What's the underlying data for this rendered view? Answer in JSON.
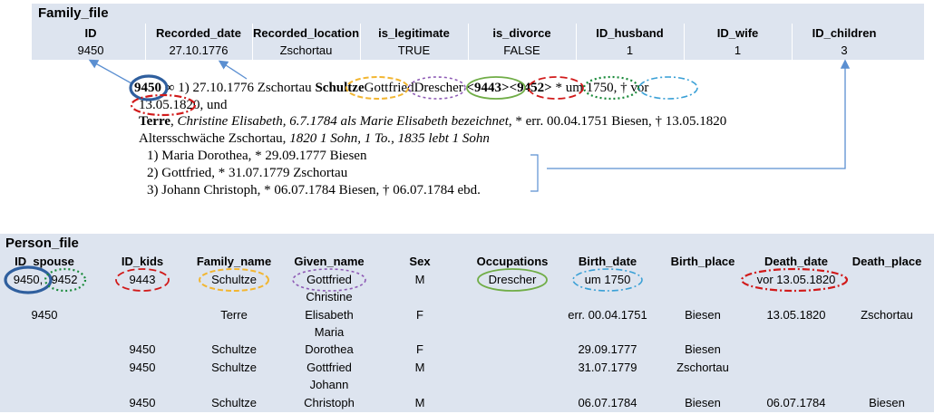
{
  "family_file": {
    "title": "Family_file",
    "headers": [
      "ID",
      "Recorded_date",
      "Recorded_location",
      "is_legitimate",
      "is_divorce",
      "ID_husband",
      "ID_wife",
      "ID_children"
    ],
    "row": [
      "9450",
      "27.10.1776",
      "Zschortau",
      "TRUE",
      "FALSE",
      "1",
      "1",
      "3"
    ]
  },
  "record": {
    "line1": {
      "id": "9450",
      "marriage_symbol": "∞",
      "text_a": "1) 27.10.1776 Zschortau",
      "family_name": "Schultze",
      "given_name": "Gottfried",
      "occupation": "Drescher",
      "id_a": "<9443>",
      "id_b": "<9452>",
      "birth": "* um 1750,",
      "death_pre": "† vor"
    },
    "line2": {
      "death_date": "13.05.1820,",
      "und": "und"
    },
    "line3": {
      "surname": "Terre",
      "given": "Christine Elisabeth,",
      "note": "6.7.1784 als Marie Elisabeth bezeichnet",
      "rest": ", * err. 00.04.1751 Biesen, † 13.05.1820"
    },
    "line4": {
      "text": "Altersschwäche Zschortau,",
      "note": "1820 1 Sohn, 1 To., 1835 lebt 1 Sohn"
    },
    "children": [
      "1) Maria Dorothea, * 29.09.1777 Biesen",
      "2) Gottfried, * 31.07.1779 Zschortau",
      "3) Johann Christoph, * 06.07.1784 Biesen, † 06.07.1784 ebd."
    ]
  },
  "person_file": {
    "title": "Person_file",
    "headers": [
      "ID_spouse",
      "ID_kids",
      "Family_name",
      "Given_name",
      "Sex",
      "Occupations",
      "Birth_date",
      "Birth_place",
      "Death_date",
      "Death_place"
    ],
    "row1": {
      "spouse_a": "9450,",
      "spouse_b": "9452",
      "kids": "9443",
      "family": "Schultze",
      "given": "Gottfried",
      "sex": "M",
      "occ": "Drescher",
      "birth": "um 1750",
      "death": "vor 13.05.1820"
    },
    "row2": {
      "spouse": "9450",
      "family": "Terre",
      "given_l1": "Christine",
      "given_l2": "Elisabeth",
      "sex": "F",
      "birth": "err. 00.04.1751",
      "birth_place": "Biesen",
      "death": "13.05.1820",
      "death_place": "Zschortau"
    },
    "row3": {
      "kids": "9450",
      "family": "Schultze",
      "given_l1": "Maria",
      "given_l2": "Dorothea",
      "sex": "F",
      "birth": "29.09.1777",
      "birth_place": "Biesen"
    },
    "row4": {
      "kids": "9450",
      "family": "Schultze",
      "given": "Gottfried",
      "sex": "M",
      "birth": "31.07.1779",
      "birth_place": "Zschortau"
    },
    "row5": {
      "kids": "9450",
      "family": "Schultze",
      "given_l1": "Johann",
      "given_l2": "Christoph",
      "sex": "M",
      "birth": "06.07.1784",
      "birth_place": "Biesen",
      "death": "06.07.1784",
      "death_place": "Biesen"
    }
  },
  "colors": {
    "table_band": "#dde4ef",
    "id_ring": "#2f5f9e",
    "arrow": "#5b8fd1",
    "family_name": "#f2b632",
    "given_name": "#8e5bb5",
    "occupation": "#70ad47",
    "id_red": "#d11a1a",
    "id_green": "#1a8a3a",
    "birth": "#3aa0d6"
  }
}
